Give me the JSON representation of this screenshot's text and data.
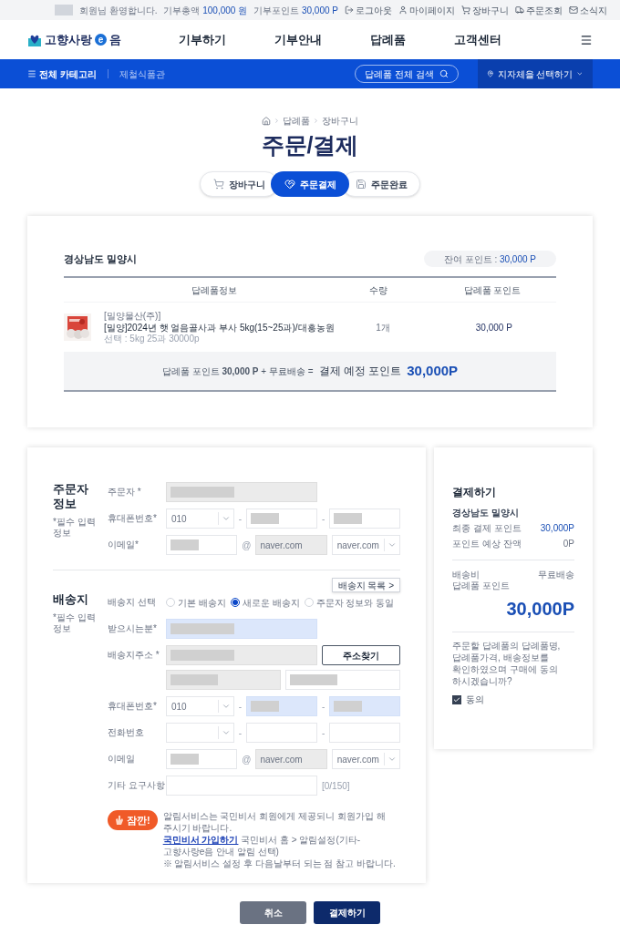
{
  "top_bar": {
    "member_masked": true,
    "welcome": "회원님 환영합니다.",
    "stats": [
      {
        "label": "기부총액",
        "value": "100,000 원"
      },
      {
        "label": "기부포인트",
        "value": "30,000 P"
      }
    ],
    "links": [
      {
        "label": "로그아웃"
      },
      {
        "label": "마이페이지"
      },
      {
        "label": "장바구니"
      },
      {
        "label": "주문조회"
      },
      {
        "label": "소식지"
      }
    ]
  },
  "header": {
    "logo": {
      "before": "고향사랑",
      "mark": "e",
      "after": "음"
    },
    "menu": [
      "기부하기",
      "기부안내",
      "답례품",
      "고객센터"
    ]
  },
  "nav": {
    "category": "전체 카테고리",
    "sub": "제철식품관",
    "search_placeholder": "답례품 전체 검색",
    "region": "지자체을 선택하기"
  },
  "breadcrumb": [
    "답례품",
    "장바구니"
  ],
  "title": "주문/결제",
  "steps": [
    {
      "label": "장바구니",
      "selected": false
    },
    {
      "label": "주문결제",
      "selected": true
    },
    {
      "label": "주문완료",
      "selected": false
    }
  ],
  "order": {
    "region": "경상남도 밀양시",
    "balance_label": "잔여 포인트 :",
    "balance": "30,000 P",
    "columns": [
      "답례품정보",
      "수량",
      "답례품 포인트"
    ],
    "items": [
      {
        "seller": "[밀양물산(주)]",
        "name": "[밀양]2024년 햇 얼음골사과 부사 5kg(15~25과)/대흥농원",
        "option": "선택 : 5kg 25과 30000p",
        "qty": "1개",
        "points": "30,000 P"
      }
    ],
    "summary": "답례품 포인트 **30,000 P** + 무료배송 =",
    "total_label": "결제 예정 포인트",
    "total": "30,000P"
  },
  "sections": [
    {
      "title": "주문자 정보",
      "note": "*필수 입력 정보",
      "rows": [
        {
          "label": "주문자 *",
          "lines": [
            [
              {
                "kind": "readonly",
                "masked": true
              }
            ]
          ]
        },
        {
          "label": "휴대폰번호*",
          "lines": [
            [
              {
                "kind": "select",
                "value": "010"
              },
              {
                "kind": "sep",
                "text": "-"
              },
              {
                "kind": "input",
                "masked": true
              },
              {
                "kind": "sep",
                "text": "-"
              },
              {
                "kind": "input",
                "masked": true
              }
            ]
          ]
        },
        {
          "label": "이메일*",
          "lines": [
            [
              {
                "kind": "input",
                "masked": true
              },
              {
                "kind": "sep",
                "text": "@"
              },
              {
                "kind": "readonly",
                "masked": false,
                "value": "naver.com"
              },
              {
                "kind": "select",
                "value": "naver.com"
              }
            ]
          ]
        }
      ]
    },
    {
      "title": "배송지",
      "note": "*필수 입력 정보",
      "action": "배송지 목록 >",
      "rows": [
        {
          "label": "배송지 선택",
          "lines": [
            [
              {
                "kind": "radio",
                "label": "기본 배송지",
                "selected": false
              },
              {
                "kind": "radio",
                "label": "새로운 배송지",
                "selected": true
              },
              {
                "kind": "radio",
                "label": "주문자 정보와 동일",
                "selected": false
              }
            ]
          ]
        },
        {
          "label": "받으시는분*",
          "lines": [
            [
              {
                "kind": "highlighted",
                "masked": true
              }
            ]
          ]
        },
        {
          "label": "배송지주소 *",
          "lines": [
            [
              {
                "kind": "readonly",
                "masked": true
              },
              {
                "kind": "button",
                "text": "주소찾기"
              }
            ],
            [
              {
                "kind": "readonly",
                "masked": true
              },
              {
                "kind": "input",
                "masked": true
              }
            ]
          ]
        },
        {
          "label": "휴대폰번호*",
          "lines": [
            [
              {
                "kind": "select",
                "value": "010"
              },
              {
                "kind": "sep",
                "text": "-"
              },
              {
                "kind": "highlighted",
                "masked": true
              },
              {
                "kind": "sep",
                "text": "-"
              },
              {
                "kind": "highlighted",
                "masked": true
              }
            ]
          ]
        },
        {
          "label": "전화번호",
          "lines": [
            [
              {
                "kind": "select"
              },
              {
                "kind": "sep",
                "text": "-"
              },
              {
                "kind": "input",
                "masked": false
              },
              {
                "kind": "sep",
                "text": "-"
              },
              {
                "kind": "input",
                "masked": false
              }
            ]
          ]
        },
        {
          "label": "이메일",
          "lines": [
            [
              {
                "kind": "input",
                "masked": true
              },
              {
                "kind": "sep",
                "text": "@"
              },
              {
                "kind": "readonly",
                "masked": false,
                "value": "naver.com"
              },
              {
                "kind": "select",
                "value": "naver.com"
              }
            ]
          ]
        },
        {
          "label": "기타 요구사항",
          "lines": [
            [
              {
                "kind": "input",
                "masked": false
              },
              {
                "kind": "counter",
                "text": "[0/150]"
              }
            ]
          ]
        }
      ]
    }
  ],
  "notice": {
    "badge": "잠깐!",
    "line1": "알림서비스는 국민비서 회원에게 제공되니 회원가입 해 주시기 바랍니다.",
    "link": "국민비서 가입하기",
    "line2": "국민비서 홈 > 알림설정(기타-고향사랑e음 안내 알림 선택)",
    "line3": "※ 알림서비스 설정 후 다음날부터 되는 점 참고 바랍니다."
  },
  "payment": {
    "title": "결제하기",
    "region": "경상남도 밀양시",
    "rows": [
      {
        "label": "최종 결제 포인트",
        "value": "30,000P",
        "emphasis": true
      },
      {
        "label": "포인트 예상 잔액",
        "value": "0P",
        "emphasis": false
      }
    ],
    "shipping_label": "배송비",
    "shipping": "무료배송",
    "points_label": "답례품 포인트",
    "total": "30,000P",
    "question": "주문할 답례품의 답례품명, 답례품가격, 배송정보를 확인하였으며 구매에 동의 하시겠습니까?",
    "agree": {
      "label": "동의",
      "checked": true
    }
  },
  "buttons": [
    {
      "kind": "secondary",
      "label": "취소"
    },
    {
      "kind": "primary",
      "label": "결제하기"
    }
  ]
}
